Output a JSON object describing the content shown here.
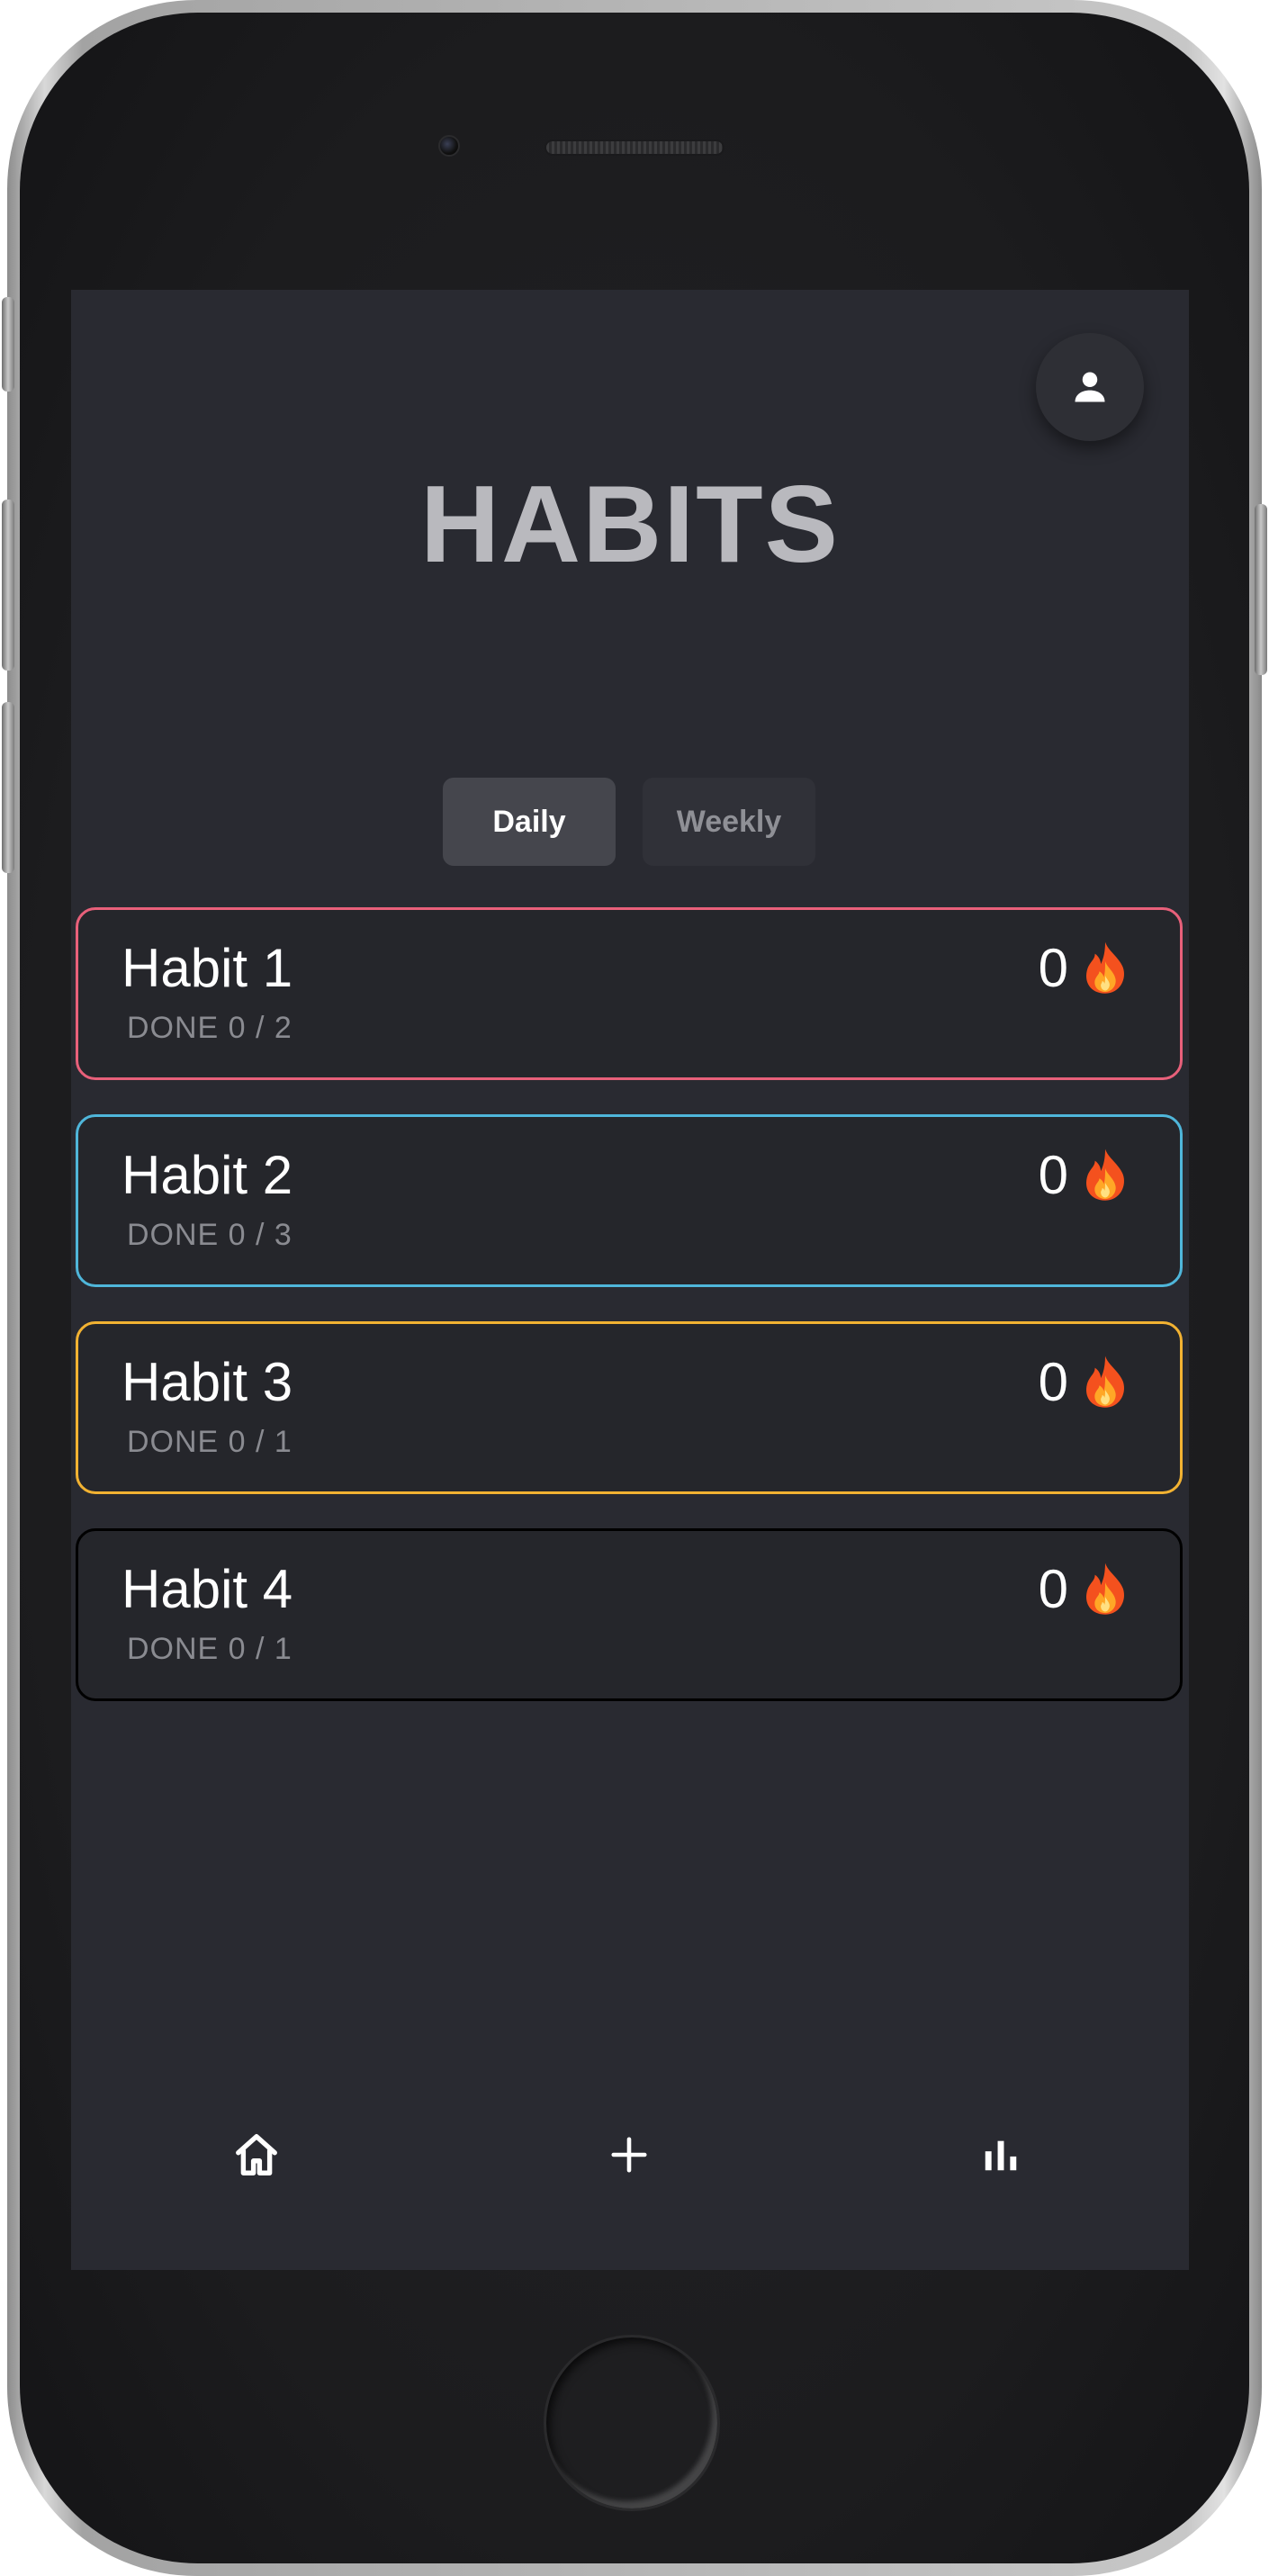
{
  "app": {
    "title": "HABITS"
  },
  "tabs": [
    {
      "label": "Daily",
      "active": true
    },
    {
      "label": "Weekly",
      "active": false
    }
  ],
  "habits": [
    {
      "name": "Habit 1",
      "progress": "DONE 0 / 2",
      "streak": "0",
      "color": "#e8607a"
    },
    {
      "name": "Habit 2",
      "progress": "DONE 0 / 3",
      "streak": "0",
      "color": "#4fb6da"
    },
    {
      "name": "Habit 3",
      "progress": "DONE 0 / 1",
      "streak": "0",
      "color": "#f2b232"
    },
    {
      "name": "Habit 4",
      "progress": "DONE 0 / 1",
      "streak": "0",
      "color": "#000000"
    }
  ],
  "icons": {
    "profile": "person-icon",
    "streak": "fire-icon",
    "nav_home": "home-icon",
    "nav_add": "plus-icon",
    "nav_stats": "bar-chart-icon"
  },
  "colors": {
    "screen_bg": "#292a31",
    "card_bg": "#25262b",
    "title": "#b9b9be",
    "active_tab": "#45464d"
  }
}
